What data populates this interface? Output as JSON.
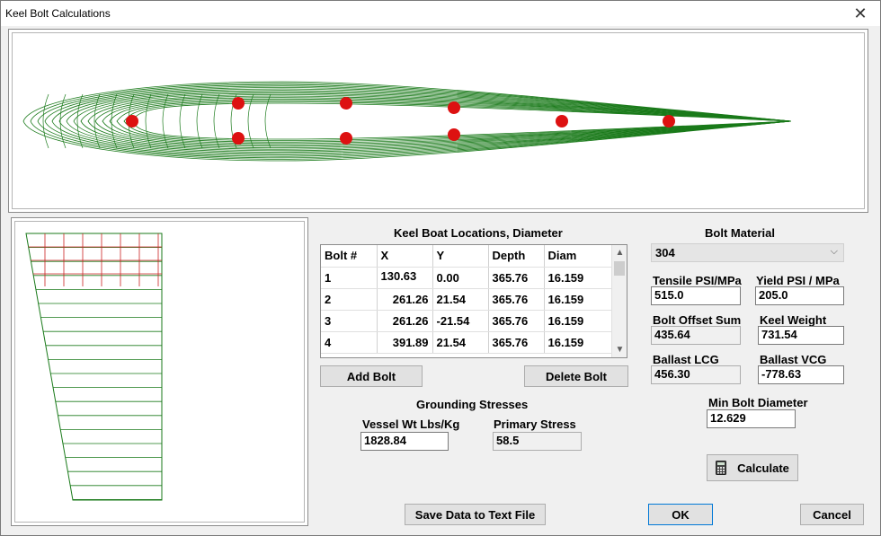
{
  "window": {
    "title": "Keel Bolt Calculations",
    "close_glyph": "✕"
  },
  "table": {
    "title": "Keel Boat Locations, Diameter",
    "columns": [
      "Bolt #",
      "X",
      "Y",
      "Depth",
      "Diam"
    ],
    "rows": [
      [
        "1",
        "130.63",
        "0.00",
        "365.76",
        "16.159"
      ],
      [
        "2",
        "261.26",
        "21.54",
        "365.76",
        "16.159"
      ],
      [
        "3",
        "261.26",
        "-21.54",
        "365.76",
        "16.159"
      ],
      [
        "4",
        "391.89",
        "21.54",
        "365.76",
        "16.159"
      ]
    ]
  },
  "buttons": {
    "add_bolt": "Add Bolt",
    "delete_bolt": "Delete Bolt",
    "save": "Save Data to Text File",
    "ok": "OK",
    "cancel": "Cancel",
    "calculate": "Calculate"
  },
  "grounding": {
    "title": "Grounding Stresses",
    "vessel_label": "Vessel Wt Lbs/Kg",
    "vessel_value": "1828.84",
    "primary_label": "Primary Stress",
    "primary_value": "58.5"
  },
  "material": {
    "title": "Bolt Material",
    "selected": "304",
    "tensile_label": "Tensile PSI/MPa",
    "tensile_value": "515.0",
    "yield_label": "Yield PSI / MPa",
    "yield_value": "205.0",
    "offset_label": "Bolt Offset Sum",
    "offset_value": "435.64",
    "keel_weight_label": "Keel Weight",
    "keel_weight_value": "731.54",
    "lcg_label": "Ballast LCG",
    "lcg_value": "456.30",
    "vcg_label": "Ballast VCG",
    "vcg_value": "-778.63",
    "min_diam_label": "Min Bolt Diameter",
    "min_diam_value": "12.629"
  },
  "colors": {
    "keel_line": "#1a7a1a",
    "bolt_marker": "#dd1111",
    "grid_red": "#cc2222"
  },
  "icons": {
    "calculator": "calculator-icon",
    "chevron": "chevron-down-icon"
  }
}
